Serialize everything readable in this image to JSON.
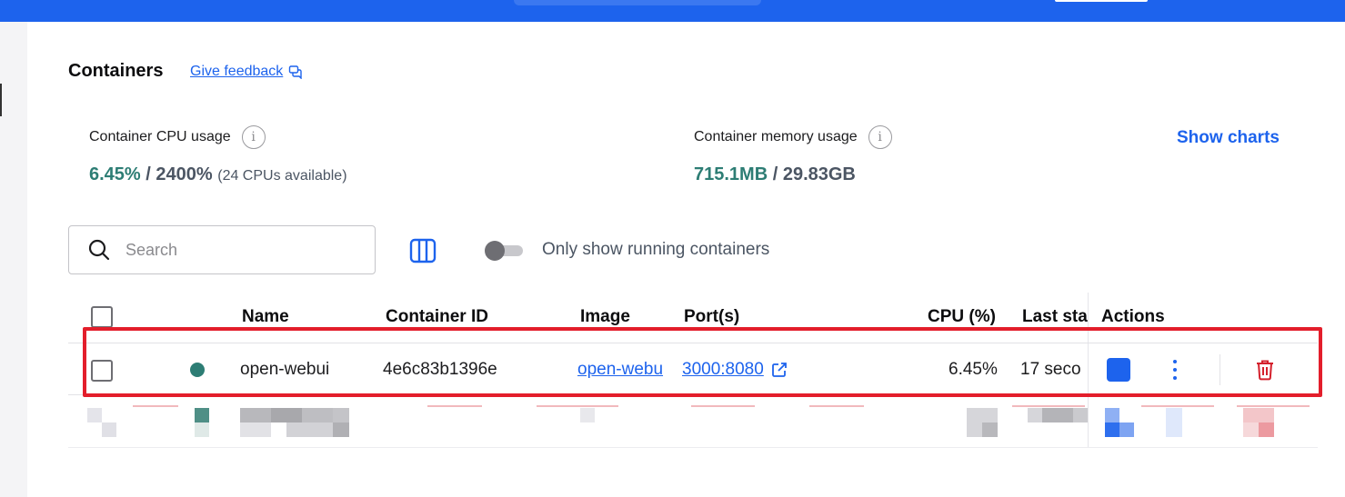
{
  "page": {
    "title": "Containers",
    "feedback_label": "Give feedback"
  },
  "stats": {
    "cpu": {
      "label": "Container CPU usage",
      "used": "6.45%",
      "separator": " / ",
      "total": "2400%",
      "note": "(24 CPUs available)"
    },
    "memory": {
      "label": "Container memory usage",
      "used": "715.1MB",
      "separator": " / ",
      "total": "29.83GB"
    },
    "show_charts_label": "Show charts"
  },
  "toolbar": {
    "search_placeholder": "Search",
    "search_value": "",
    "running_toggle_label": "Only show running containers",
    "running_toggle_on": false
  },
  "table": {
    "headers": {
      "name": "Name",
      "container_id": "Container ID",
      "image": "Image",
      "ports": "Port(s)",
      "cpu": "CPU (%)",
      "last_started": "Last sta",
      "actions": "Actions"
    },
    "rows": [
      {
        "status": "running",
        "name": "open-webui",
        "container_id": "4e6c83b1396e",
        "image": "open-webu",
        "ports": "3000:8080",
        "cpu": "6.45%",
        "last_started": "17 seco"
      }
    ]
  },
  "colors": {
    "accent": "#1d63ed",
    "running": "#2d7d74",
    "highlight": "#e31e2b",
    "delete": "#d4202c"
  },
  "icons": {
    "feedback": "feedback-icon",
    "info": "info-icon",
    "search": "search-icon",
    "columns": "columns-icon",
    "external_link": "external-link-icon",
    "stop": "stop-icon",
    "more": "kebab-icon",
    "delete": "trash-icon"
  }
}
